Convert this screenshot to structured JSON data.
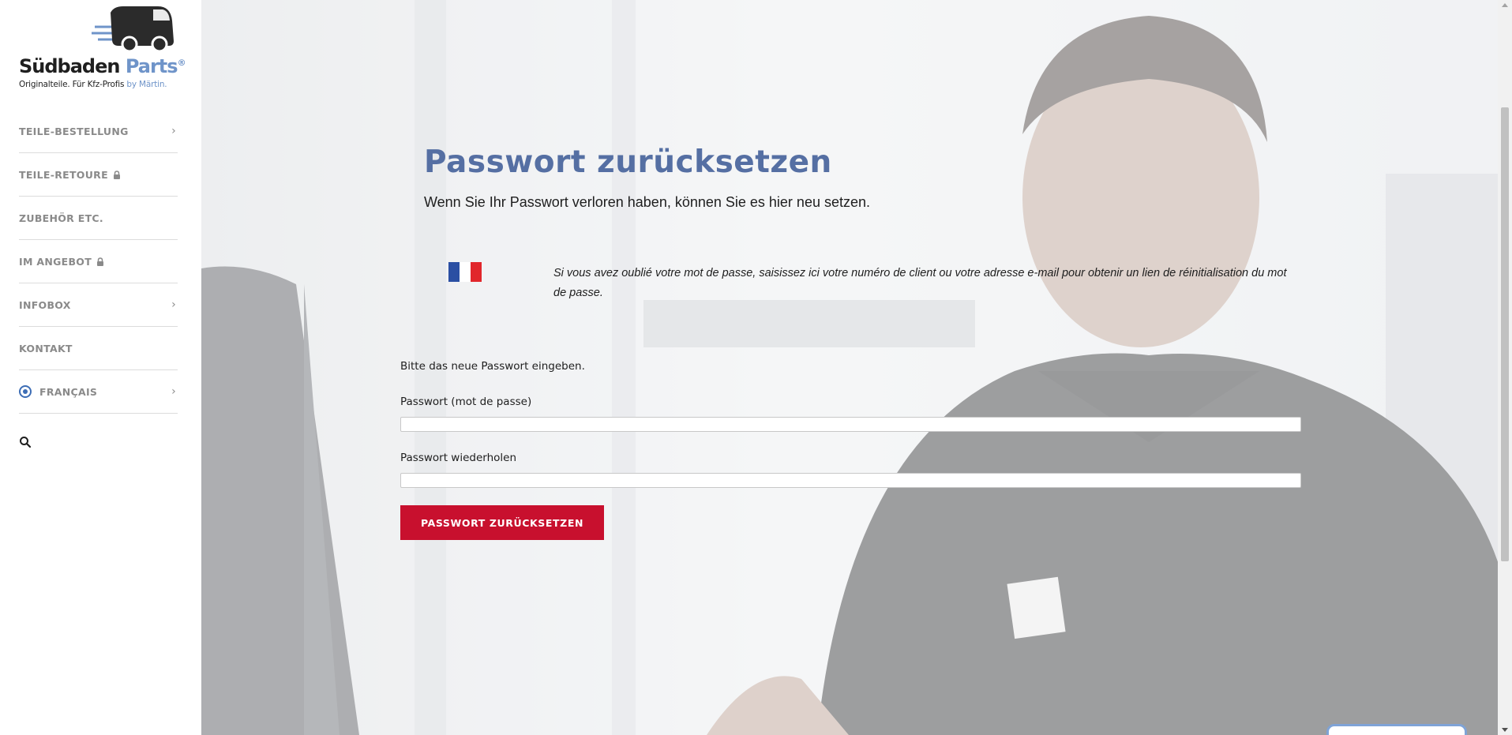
{
  "brand": {
    "name_primary": "Südbaden",
    "name_accent": "Parts",
    "registered_mark": "®",
    "tagline": "Originalteile. Für Kfz-Profis",
    "tagline_by": "by Märtin."
  },
  "nav": {
    "items": [
      {
        "label": "TEILE-BESTELLUNG",
        "icon": "chevron-right-icon"
      },
      {
        "label": "TEILE-RETOURE",
        "icon": "lock-icon"
      },
      {
        "label": "ZUBEHÖR ETC."
      },
      {
        "label": "IM ANGEBOT",
        "icon": "lock-icon"
      },
      {
        "label": "INFOBOX",
        "icon": "chevron-right-icon"
      },
      {
        "label": "KONTAKT"
      },
      {
        "label": "FRANÇAIS",
        "icon": "globe-icon"
      }
    ],
    "search_icon": "search-icon"
  },
  "page": {
    "title": "Passwort zurücksetzen",
    "subtitle": "Wenn Sie Ihr Passwort verloren haben, können Sie es hier neu setzen.",
    "fr_note": "Si vous avez oublié votre mot de passe, saisissez ici votre numéro de client ou votre adresse e-mail pour obtenir un lien de réinitialisation du mot de passe."
  },
  "form": {
    "intro": "Bitte das neue Passwort eingeben.",
    "password_label": "Passwort (mot de passe)",
    "password_value": "",
    "password_repeat_label": "Passwort wiederholen",
    "password_repeat_value": "",
    "submit_label": "PASSWORT ZURÜCKSETZEN"
  },
  "colors": {
    "title_blue": "#556fa3",
    "button_red": "#c8102e",
    "brand_blue": "#6f94c9",
    "flag_blue": "#2b4fa3",
    "flag_white": "#ffffff",
    "flag_red": "#e1262b"
  }
}
